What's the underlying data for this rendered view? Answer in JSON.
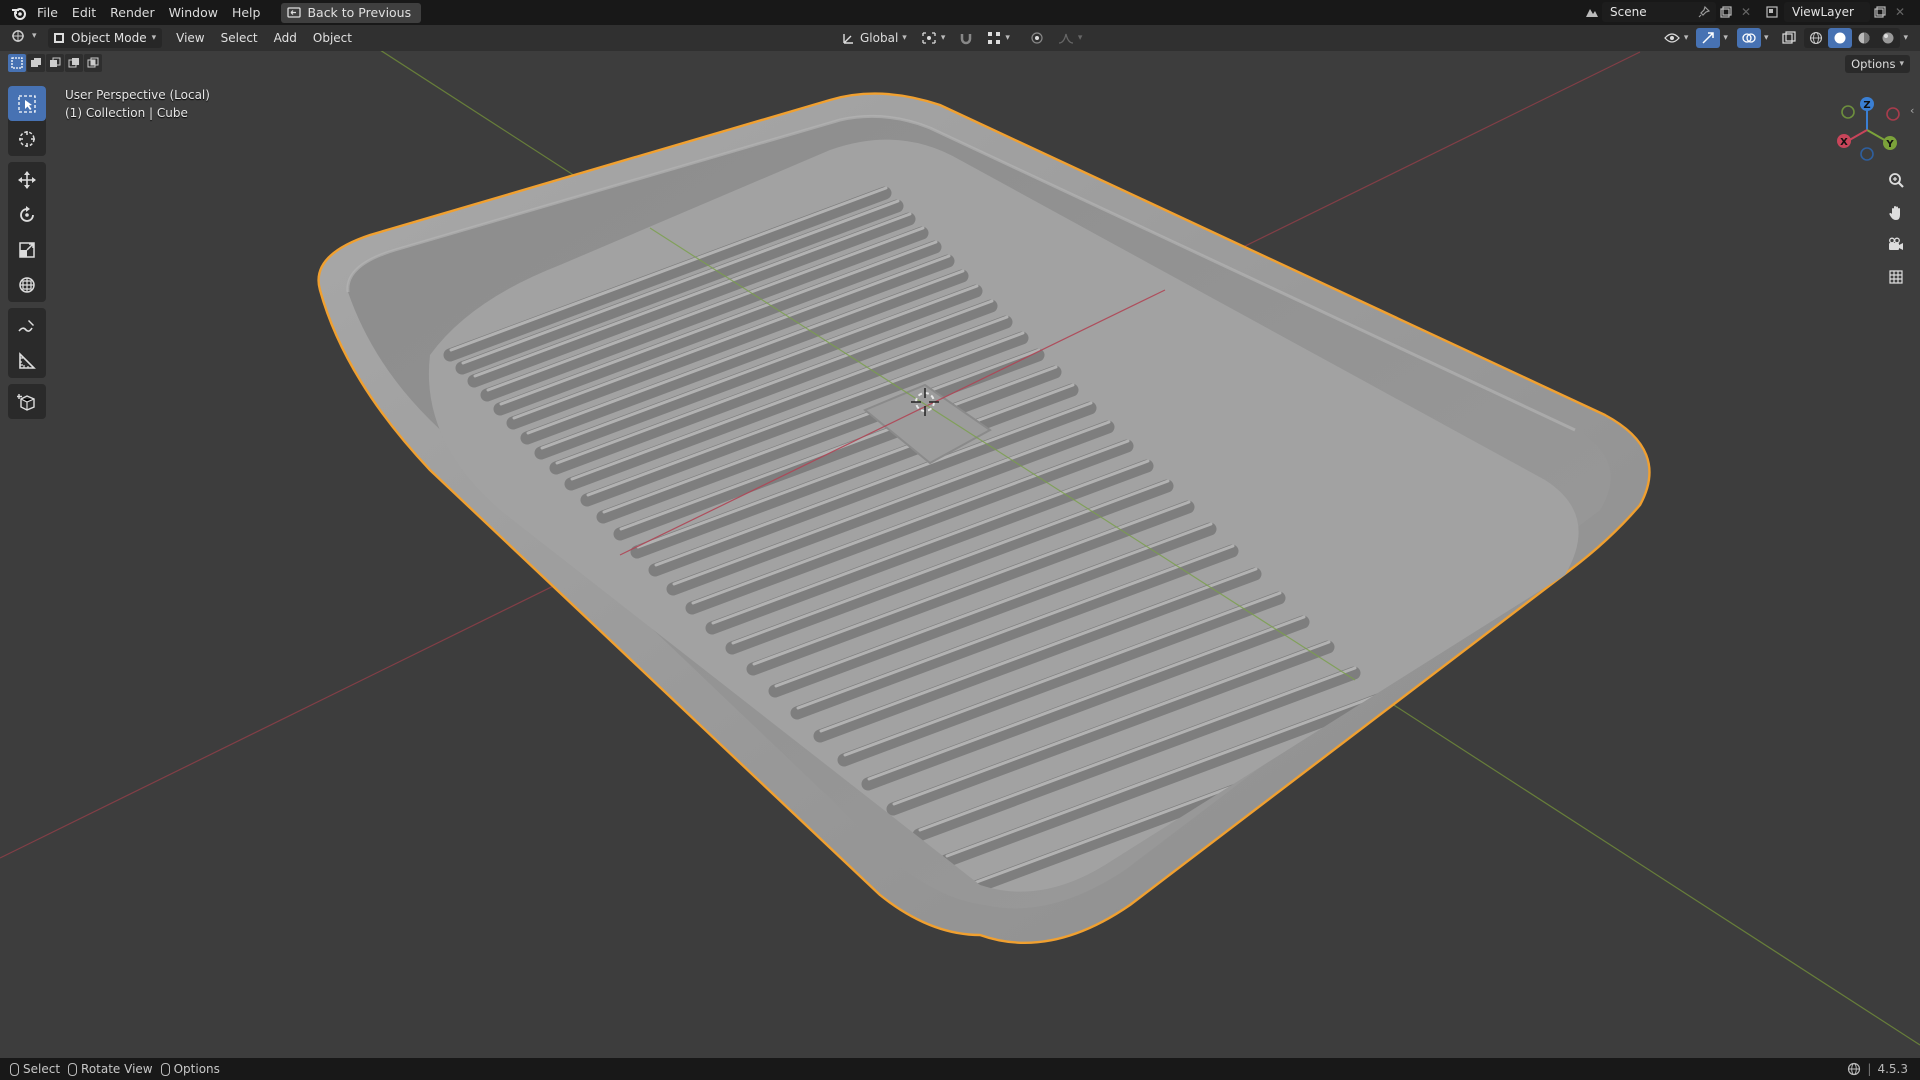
{
  "menubar": {
    "items": [
      "File",
      "Edit",
      "Render",
      "Window",
      "Help"
    ],
    "back_label": "Back to Previous",
    "scene_label": "Scene",
    "viewlayer_label": "ViewLayer"
  },
  "header": {
    "mode_label": "Object Mode",
    "menus": [
      "View",
      "Select",
      "Add",
      "Object"
    ],
    "orientation_label": "Global",
    "options_label": "Options"
  },
  "viewport": {
    "perspective_label": "User Perspective (Local)",
    "collection_label": "(1) Collection | Cube"
  },
  "gizmo": {
    "z_label": "Z",
    "y_label": "Y",
    "x_label": "X"
  },
  "statusbar": {
    "select_label": "Select",
    "rotate_label": "Rotate View",
    "options_label": "Options",
    "version": "4.5.3"
  },
  "colors": {
    "accent": "#4772b3",
    "selection_outline": "#f0a030",
    "x_axis": "#c8455a",
    "y_axis": "#7ba23a",
    "z_axis": "#3a7fd4",
    "background": "#3d3d3d"
  }
}
